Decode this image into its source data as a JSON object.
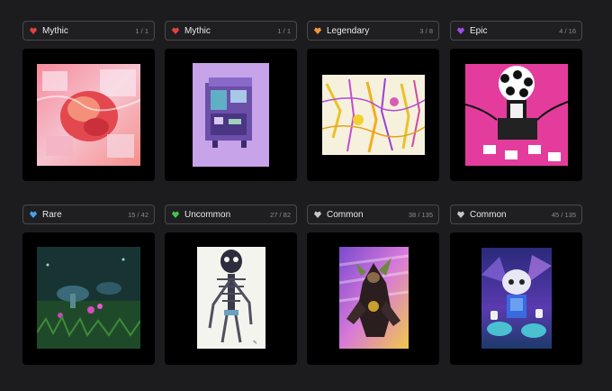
{
  "cards": [
    {
      "rarity": "Mythic",
      "count": "1 / 1",
      "gem_color": "#e0433c",
      "icon": "heart-gem-icon"
    },
    {
      "rarity": "Mythic",
      "count": "1 / 1",
      "gem_color": "#e0433c",
      "icon": "heart-gem-icon"
    },
    {
      "rarity": "Legendary",
      "count": "3 / 8",
      "gem_color": "#f0963a",
      "icon": "heart-gem-icon"
    },
    {
      "rarity": "Epic",
      "count": "4 / 16",
      "gem_color": "#a04ee0",
      "icon": "heart-gem-icon"
    },
    {
      "rarity": "Rare",
      "count": "15 / 42",
      "gem_color": "#4aa0e6",
      "icon": "heart-gem-icon"
    },
    {
      "rarity": "Uncommon",
      "count": "27 / 82",
      "gem_color": "#42c24a",
      "icon": "heart-gem-icon"
    },
    {
      "rarity": "Common",
      "count": "38 / 135",
      "gem_color": "#c8c8cc",
      "icon": "heart-gem-icon"
    },
    {
      "rarity": "Common",
      "count": "45 / 135",
      "gem_color": "#c8c8cc",
      "icon": "heart-gem-icon"
    }
  ]
}
